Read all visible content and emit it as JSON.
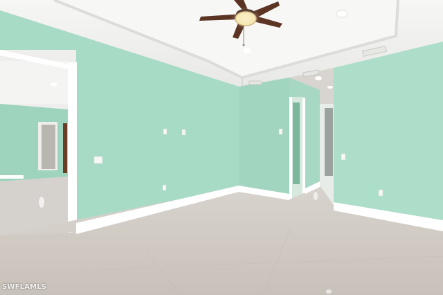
{
  "photo": {
    "watermark": "SWFLAMLS"
  },
  "colors": {
    "wall": "#a9dcc7",
    "wall_shadow": "#9bd0bb",
    "ceiling": "#f2f3f1",
    "floor": "#cfc9c2",
    "baseboard": "#ffffff",
    "fan_blade": "#5b3424",
    "fan_light": "#f4e3a8"
  }
}
